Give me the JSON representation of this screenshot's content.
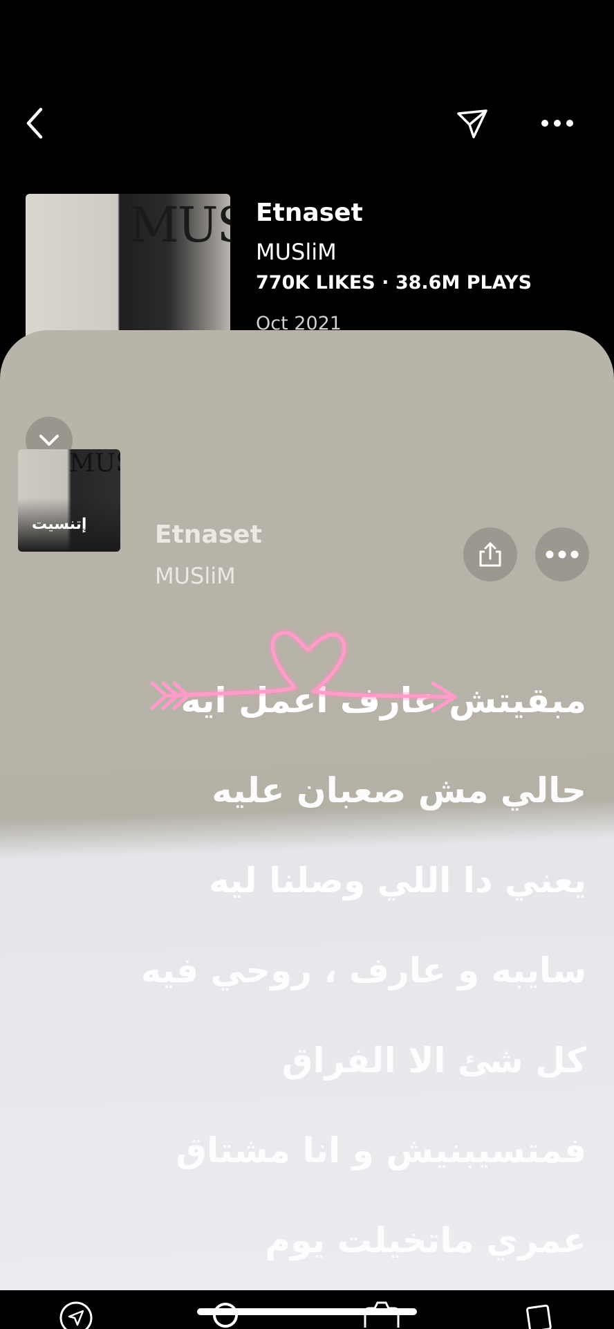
{
  "header": {
    "title": "Etnaset",
    "artist": "MUSliM",
    "likes": "770K LIKES",
    "plays": "38.6M PLAYS",
    "stats_separator": "·",
    "date": "Oct 2021",
    "cover_text": "MUSliM"
  },
  "sheet": {
    "title": "Etnaset",
    "artist": "MUSliM",
    "cover_text": "MUSliM",
    "cover_arabic": "إتنسيت"
  },
  "lyrics": [
    "مبقيتش عارف اعمل ايه",
    "حالي مش صعبان عليه",
    "يعني دا اللي وصلنا ليه",
    "سايبه و عارف ، روحي فيه",
    "كل شئ الا الفراق",
    "فمتسيبنيش و انا مشتاق",
    "عمري ماتخيلت يوم"
  ],
  "colors": {
    "active_lyric": "#ffffff",
    "upcoming_lyric": "#ffffff",
    "neon": "#ff8ec4",
    "sheet_top": "#b8b4a9",
    "sheet_bottom": "#ececf0"
  },
  "icons": {
    "back": "chevron-left-icon",
    "send": "paper-plane-icon",
    "more": "ellipsis-icon",
    "collapse": "chevron-down-icon",
    "share": "share-icon",
    "nav": [
      "messages-icon",
      "search-icon",
      "camera-icon",
      "stack-icon"
    ]
  }
}
